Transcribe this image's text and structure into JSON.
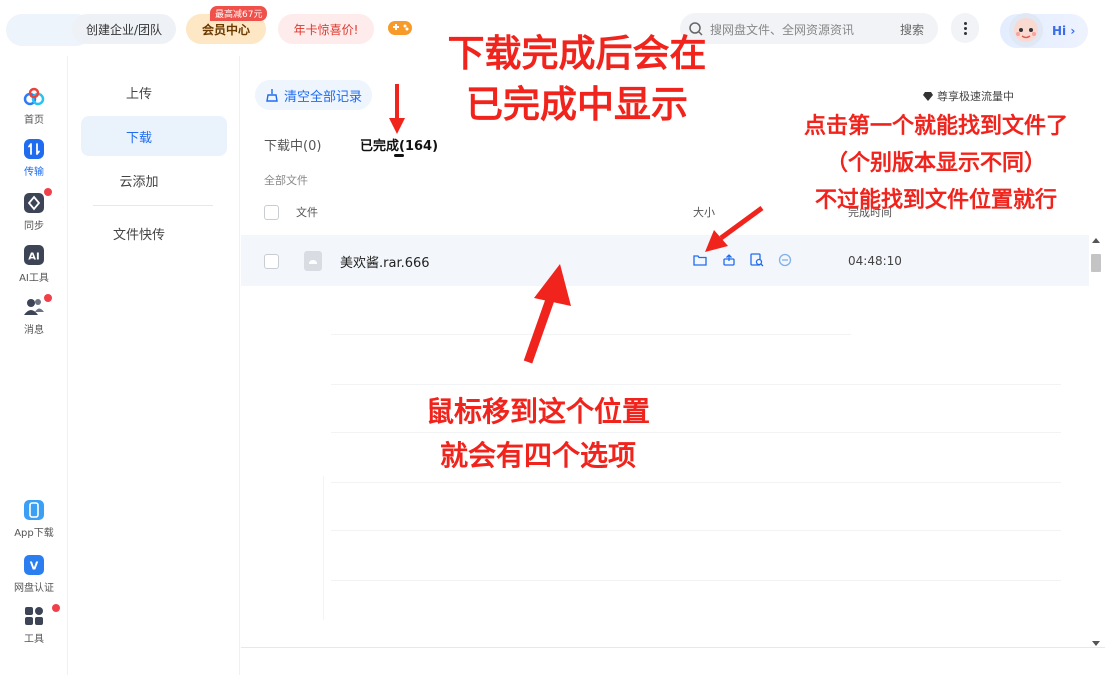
{
  "topbar": {
    "org_label": "创建企业/团队",
    "vip_label": "会员中心",
    "vip_badge": "最高减67元",
    "card_promo": "年卡惊喜价!",
    "search_placeholder": "搜网盘文件、全网资源资讯",
    "search_button": "搜索",
    "hi_label": "Hi"
  },
  "rail": {
    "items": [
      {
        "label": "首页",
        "icon": "cloud-home-icon"
      },
      {
        "label": "传输",
        "icon": "transfer-icon"
      },
      {
        "label": "同步",
        "icon": "sync-icon"
      },
      {
        "label": "AI工具",
        "icon": "ai-tools-icon"
      },
      {
        "label": "消息",
        "icon": "messages-icon"
      },
      {
        "label": "App下载",
        "icon": "phone-icon"
      },
      {
        "label": "网盘认证",
        "icon": "verify-shield-icon"
      },
      {
        "label": "工具",
        "icon": "grid-tools-icon"
      }
    ]
  },
  "subnav": {
    "items": [
      "上传",
      "下载",
      "云添加",
      "文件快传"
    ]
  },
  "main": {
    "clear_all": "清空全部记录",
    "speed_note": "尊享极速流量中",
    "tabs": [
      "下载中(0)",
      "已完成(164)"
    ],
    "breadcrumb": "全部文件",
    "columns": {
      "file": "文件",
      "size": "大小",
      "time": "完成时间"
    },
    "rows": [
      {
        "name": "美欢酱.rar.666",
        "time": "04:48:10"
      }
    ]
  },
  "annotations": {
    "top_line1": "下载完成后会在",
    "top_line2": "已完成中显示",
    "right_line1": "点击第一个就能找到文件了",
    "right_line2": "（个别版本显示不同）",
    "right_line3": "不过能找到文件位置就行",
    "mid_line1": "鼠标移到这个位置",
    "mid_line2": "就会有四个选项"
  },
  "colors": {
    "accent": "#1f6cf0",
    "annotation": "#f0241c",
    "promo_red": "#e0362d"
  }
}
